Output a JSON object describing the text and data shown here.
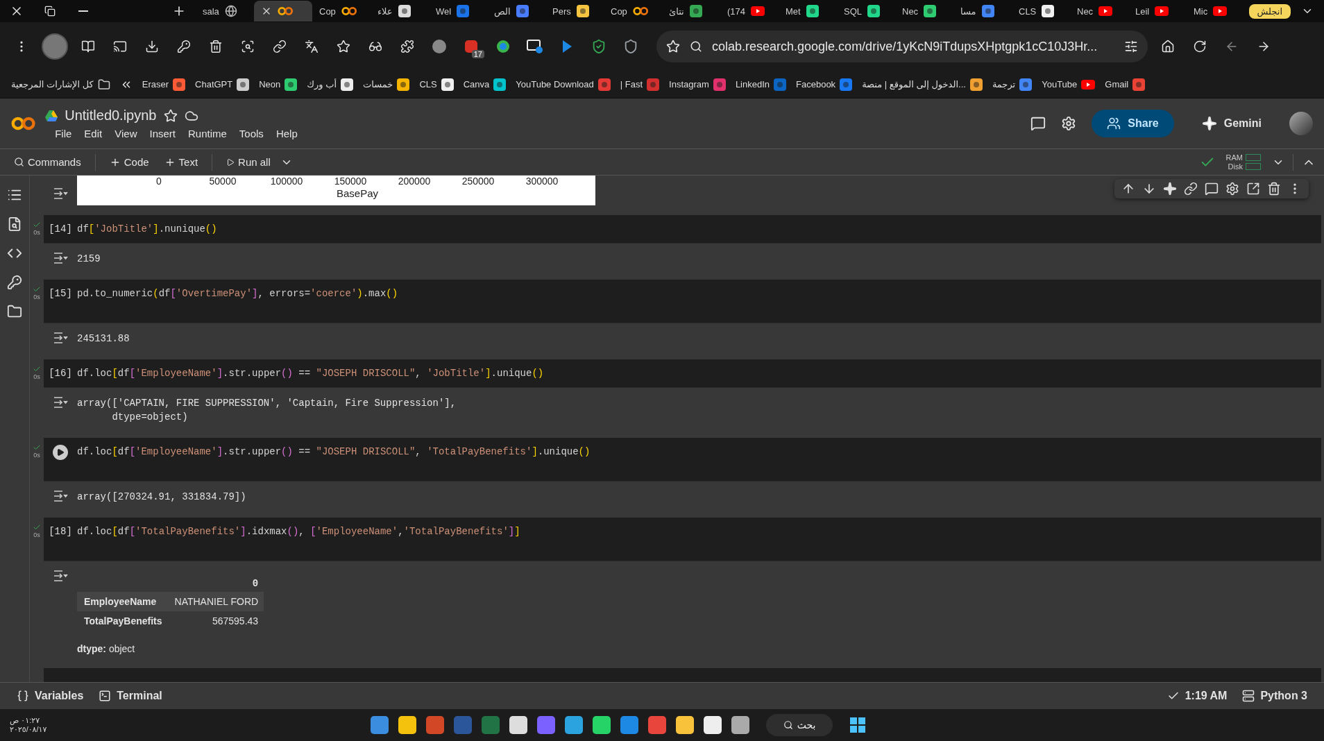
{
  "browser": {
    "tabs": [
      {
        "title": "sala",
        "kind": "globe",
        "selected": false
      },
      {
        "kind": "colab",
        "selected": true
      },
      {
        "title": "Cop",
        "kind": "colab",
        "selected": false
      },
      {
        "title": "علاء",
        "kind": "chrome",
        "selected": false
      },
      {
        "title": "Wel",
        "kind": "arrow",
        "selected": false
      },
      {
        "title": "الص",
        "kind": "circle",
        "selected": false
      },
      {
        "title": "Pers",
        "kind": "yellow",
        "selected": false
      },
      {
        "title": "Cop",
        "kind": "colab",
        "selected": false
      },
      {
        "title": "نتائ",
        "kind": "drive",
        "selected": false
      },
      {
        "title": "(174",
        "kind": "youtube",
        "selected": false
      },
      {
        "title": "Met",
        "kind": "green",
        "selected": false
      },
      {
        "title": "SQL",
        "kind": "green",
        "selected": false
      },
      {
        "title": "Nec",
        "kind": "neon",
        "selected": false
      },
      {
        "title": "مسا",
        "kind": "docs",
        "selected": false
      },
      {
        "title": "CLS",
        "kind": "cls",
        "selected": false
      },
      {
        "title": "Nec",
        "kind": "youtube",
        "selected": false
      },
      {
        "title": "Leil",
        "kind": "youtube",
        "selected": false
      },
      {
        "title": "Mic",
        "kind": "youtube",
        "selected": false
      }
    ],
    "profile_button": "انجلش",
    "extension_badge": "17",
    "address": "colab.research.google.com/drive/1yKcN9iTdupsXHptgpk1cC10J3Hr...",
    "bookmarks": [
      {
        "label": "كل الإشارات المرجعية",
        "kind": "folder"
      },
      {
        "label": "Eraser",
        "kind": "eraser"
      },
      {
        "label": "ChatGPT",
        "kind": "chatgpt"
      },
      {
        "label": "Neon",
        "kind": "neon"
      },
      {
        "label": "أب ورك",
        "kind": "upwork"
      },
      {
        "label": "خمسات",
        "kind": "khamsat"
      },
      {
        "label": "CLS",
        "kind": "cls"
      },
      {
        "label": "Canva",
        "kind": "canva"
      },
      {
        "label": "YouTube Download",
        "kind": "download"
      },
      {
        "label": "| Fast",
        "kind": "fast"
      },
      {
        "label": "Instagram",
        "kind": "instagram"
      },
      {
        "label": "LinkedIn",
        "kind": "linkedin"
      },
      {
        "label": "Facebook",
        "kind": "facebook"
      },
      {
        "label": "الدخول إلى الموقع | منصة...",
        "kind": "mostaql"
      },
      {
        "label": "ترجمة",
        "kind": "translate"
      },
      {
        "label": "YouTube",
        "kind": "youtube"
      },
      {
        "label": "Gmail",
        "kind": "gmail"
      }
    ]
  },
  "colab": {
    "title": "Untitled0.ipynb",
    "menu": [
      "File",
      "Edit",
      "View",
      "Insert",
      "Runtime",
      "Tools",
      "Help"
    ],
    "share": "Share",
    "gemini": "Gemini",
    "toolbar": {
      "commands": "Commands",
      "code": "Code",
      "text": "Text",
      "run_all": "Run all"
    },
    "ram": "RAM",
    "disk": "Disk"
  },
  "chart_stub": {
    "tick_labels": [
      "0",
      "50000",
      "100000",
      "150000",
      "200000",
      "250000",
      "300000"
    ],
    "axis_label": "BasePay"
  },
  "cells": [
    {
      "prompt": "[14]",
      "time": "0s",
      "show_run_button": false,
      "trailing_blank_line": false,
      "code": "df['JobTitle'].nunique()",
      "output": {
        "kind": "text",
        "lines": [
          "2159"
        ]
      }
    },
    {
      "prompt": "[15]",
      "time": "0s",
      "show_run_button": false,
      "trailing_blank_line": true,
      "code": "pd.to_numeric(df['OvertimePay'], errors='coerce').max()",
      "output": {
        "kind": "text",
        "lines": [
          "245131.88"
        ]
      }
    },
    {
      "prompt": "[16]",
      "time": "0s",
      "show_run_button": false,
      "trailing_blank_line": false,
      "code": "df.loc[df['EmployeeName'].str.upper() == \"JOSEPH DRISCOLL\", 'JobTitle'].unique()",
      "output": {
        "kind": "text",
        "lines": [
          "array(['CAPTAIN, FIRE SUPPRESSION', 'Captain, Fire Suppression'],",
          "      dtype=object)"
        ]
      }
    },
    {
      "time": "0s",
      "show_run_button": true,
      "trailing_blank_line": true,
      "code": "df.loc[df['EmployeeName'].str.upper() == \"JOSEPH DRISCOLL\", 'TotalPayBenefits'].unique()",
      "output": {
        "kind": "text",
        "lines": [
          "array([270324.91, 331834.79])"
        ]
      }
    },
    {
      "prompt": "[18]",
      "time": "0s",
      "show_run_button": false,
      "trailing_blank_line": true,
      "code": "df.loc[df['TotalPayBenefits'].idxmax(), ['EmployeeName','TotalPayBenefits']]",
      "output": {
        "kind": "series",
        "header": "0",
        "rows": [
          {
            "name": "EmployeeName",
            "value": "NATHANIEL FORD"
          },
          {
            "name": "TotalPayBenefits",
            "value": "567595.43"
          }
        ],
        "dtype": "**dtype:** object"
      }
    }
  ],
  "status": {
    "variables": "Variables",
    "terminal": "Terminal",
    "time": "1:19 AM",
    "runtime": "Python 3"
  },
  "taskbar": {
    "time": "٠١:٢٧ ص",
    "date": "٢٠٢٥/٠٨/١٧",
    "search": "بحث"
  }
}
